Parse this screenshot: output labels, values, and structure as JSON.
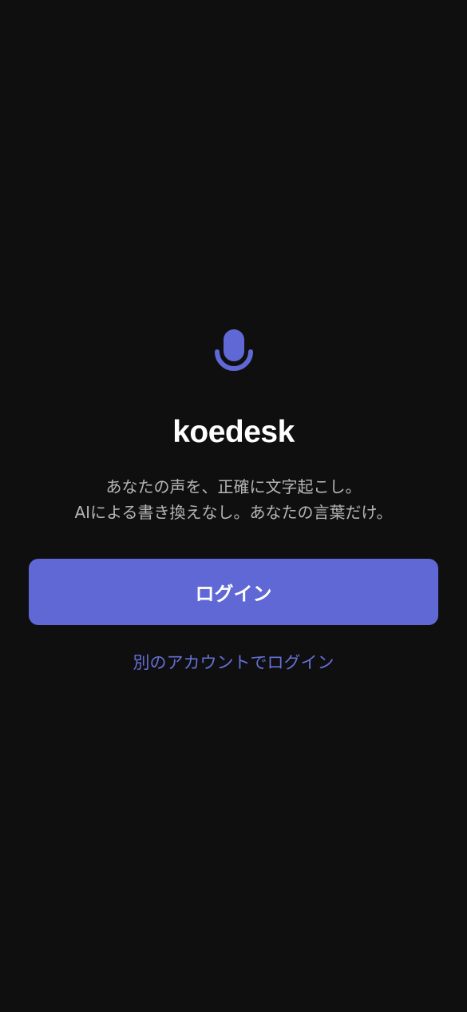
{
  "app": {
    "title": "koedesk",
    "icon": "microphone-icon",
    "tagline_line1": "あなたの声を、正確に文字起こし。",
    "tagline_line2": "AIによる書き換えなし。あなたの言葉だけ。"
  },
  "actions": {
    "login_label": "ログイン",
    "alt_login_label": "別のアカウントでログイン"
  },
  "colors": {
    "background": "#0f0f0f",
    "accent": "#5f68d4",
    "link": "#6670d8",
    "title": "#ffffff",
    "tagline": "#b5b5b5"
  }
}
